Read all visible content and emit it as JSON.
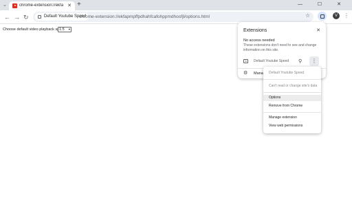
{
  "browser": {
    "tab_title": "chrome-extension://ekfapmpffpd",
    "tab_close": "✕",
    "new_tab": "+",
    "window_controls": "— ☐ ✕",
    "tab_search": "⌄"
  },
  "toolbar": {
    "back": "←",
    "forward": "→",
    "reload": "↻",
    "site_chip": "Default Youtube Speed",
    "url": "chrome-extension://ekfapmpffpdhahfcafohppmdhoofjl/options.html",
    "star": "☆",
    "profile_initial": "V",
    "menu": "⋮"
  },
  "page": {
    "label": "Choose default video playback speed:",
    "speed_value": "1.5",
    "speed_arrow": "▾"
  },
  "extensions_panel": {
    "title": "Extensions",
    "close": "✕",
    "section": "No access needed",
    "description": "These extensions don't need to see and change information on this site.",
    "extension_name": "Default Youtube Speed",
    "pin_icon": "⚲",
    "menu_icon": "⋮",
    "manage_label": "Manage extensions",
    "gear_icon": "⚙"
  },
  "context_menu": {
    "items": [
      "Default Youtube Speed",
      "Can't read or change site's data",
      "Options",
      "Remove from Chrome",
      "Manage extension",
      "View web permissions"
    ]
  },
  "colors": {
    "tabstrip": "#dfe3e8",
    "omnibox": "#eef1f6",
    "accent_extbtn": "#d3e3fd",
    "favicon": "#d93025"
  }
}
